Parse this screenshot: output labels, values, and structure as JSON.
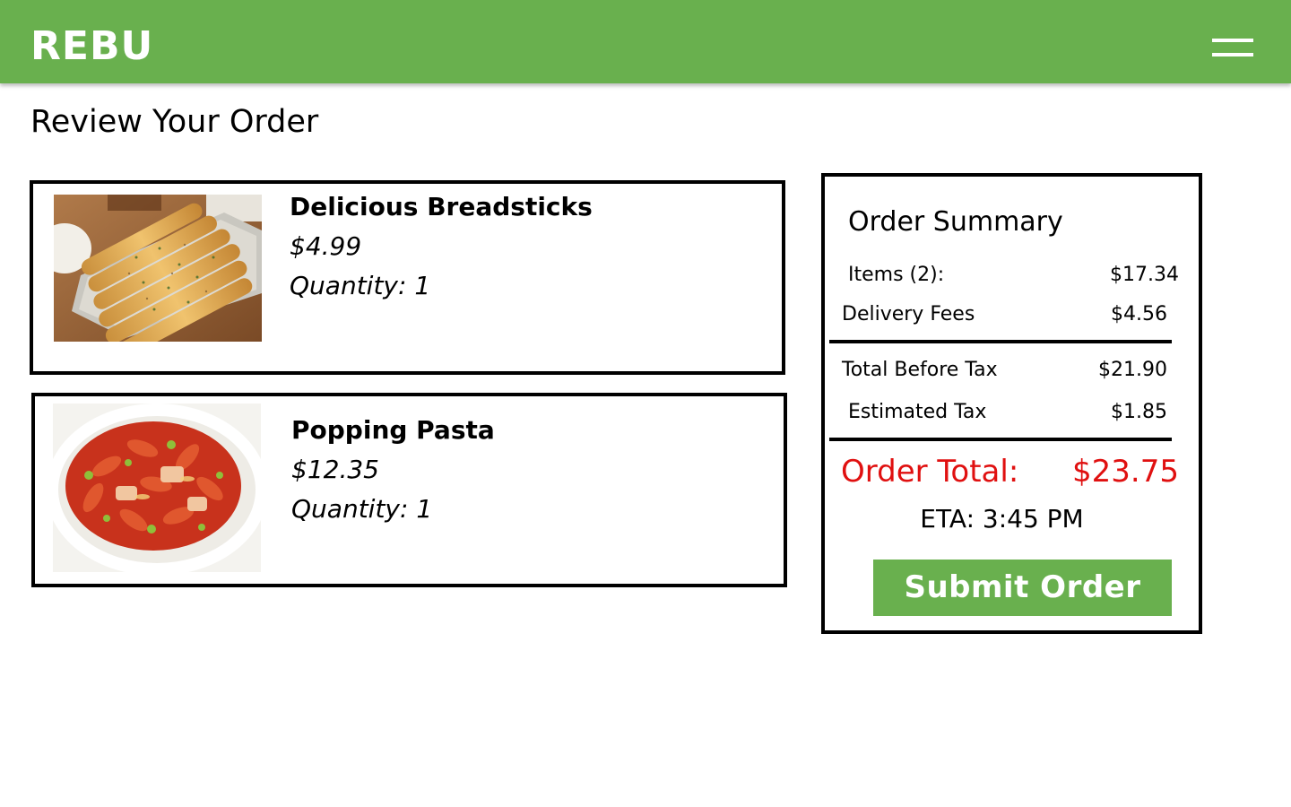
{
  "header": {
    "brand": "REBU",
    "menu_icon": "hamburger-menu-icon",
    "background_color": "#69b04e"
  },
  "page_title": "Review Your Order",
  "cart": {
    "items": [
      {
        "name": "Delicious Breadsticks",
        "price": "$4.99",
        "quantity": "Quantity: 1",
        "image": "breadsticks-image"
      },
      {
        "name": "Popping Pasta",
        "price": "$12.35",
        "quantity": "Quantity: 1",
        "image": "pasta-image"
      }
    ]
  },
  "summary": {
    "title": "Order Summary",
    "rows": [
      {
        "label": "Items (2):",
        "value": "$17.34"
      },
      {
        "label": "Delivery Fees",
        "value": "$4.56"
      },
      {
        "label": "Total Before Tax",
        "value": "$21.90"
      },
      {
        "label": "Estimated Tax",
        "value": "$1.85"
      }
    ],
    "total_label": "Order Total:",
    "total_value": "$23.75",
    "total_color": "#e01010",
    "eta": "ETA: 3:45 PM",
    "submit_label": "Submit Order"
  }
}
